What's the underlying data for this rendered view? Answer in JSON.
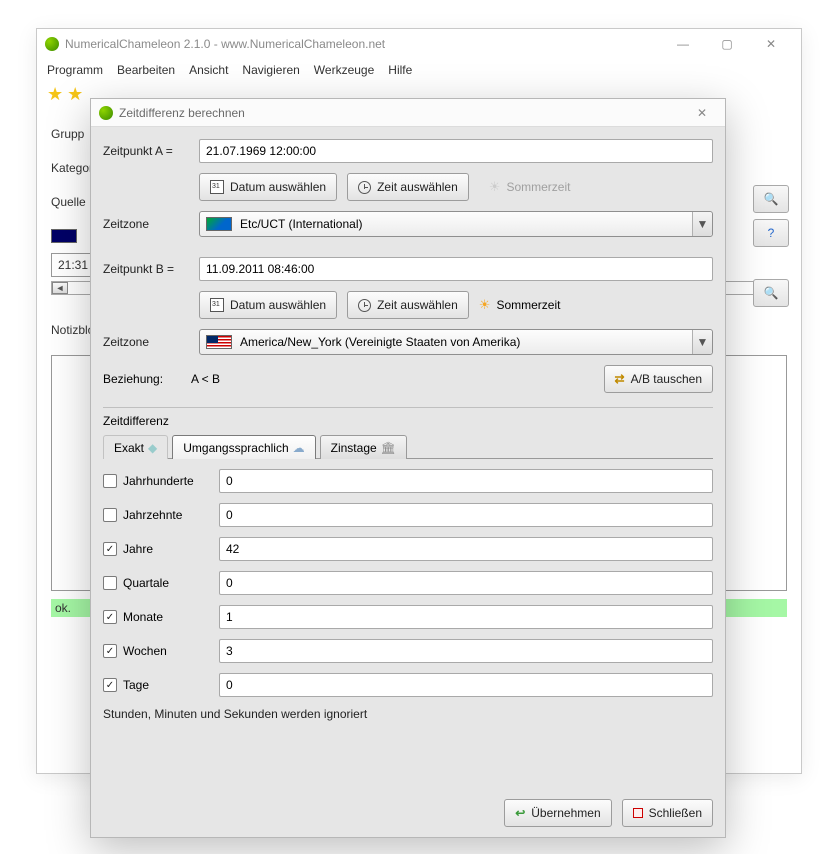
{
  "main": {
    "title": "NumericalChameleon 2.1.0 - www.NumericalChameleon.net",
    "menu": [
      "Programm",
      "Bearbeiten",
      "Ansicht",
      "Navigieren",
      "Werkzeuge",
      "Hilfe"
    ],
    "labels": {
      "gruppe": "Grupp",
      "kategorie": "Kategor",
      "quelle": "Quelle",
      "notiz": "Notizblo"
    },
    "time": "21:31",
    "status": "ok."
  },
  "dialog": {
    "title": "Zeitdifferenz berechnen",
    "pointA": {
      "label": "Zeitpunkt A =",
      "value": "21.07.1969 12:00:00"
    },
    "pointB": {
      "label": "Zeitpunkt B =",
      "value": "11.09.2011 08:46:00"
    },
    "buttons": {
      "datum": "Datum auswählen",
      "zeit": "Zeit auswählen",
      "sommer": "Sommerzeit",
      "swap": "A/B tauschen",
      "apply": "Übernehmen",
      "close": "Schließen"
    },
    "zoneLabel": "Zeitzone",
    "zoneA": "Etc/UCT (International)",
    "zoneB": "America/New_York (Vereinigte Staaten von Amerika)",
    "relation": {
      "label": "Beziehung:",
      "value": "A < B"
    },
    "diffTitle": "Zeitdifferenz",
    "tabs": [
      "Exakt",
      "Umgangssprachlich",
      "Zinstage"
    ],
    "rows": [
      {
        "label": "Jahrhunderte",
        "checked": false,
        "value": "0"
      },
      {
        "label": "Jahrzehnte",
        "checked": false,
        "value": "0"
      },
      {
        "label": "Jahre",
        "checked": true,
        "value": "42"
      },
      {
        "label": "Quartale",
        "checked": false,
        "value": "0"
      },
      {
        "label": "Monate",
        "checked": true,
        "value": "1"
      },
      {
        "label": "Wochen",
        "checked": true,
        "value": "3"
      },
      {
        "label": "Tage",
        "checked": true,
        "value": "0"
      }
    ],
    "note": "Stunden, Minuten und Sekunden werden ignoriert"
  }
}
